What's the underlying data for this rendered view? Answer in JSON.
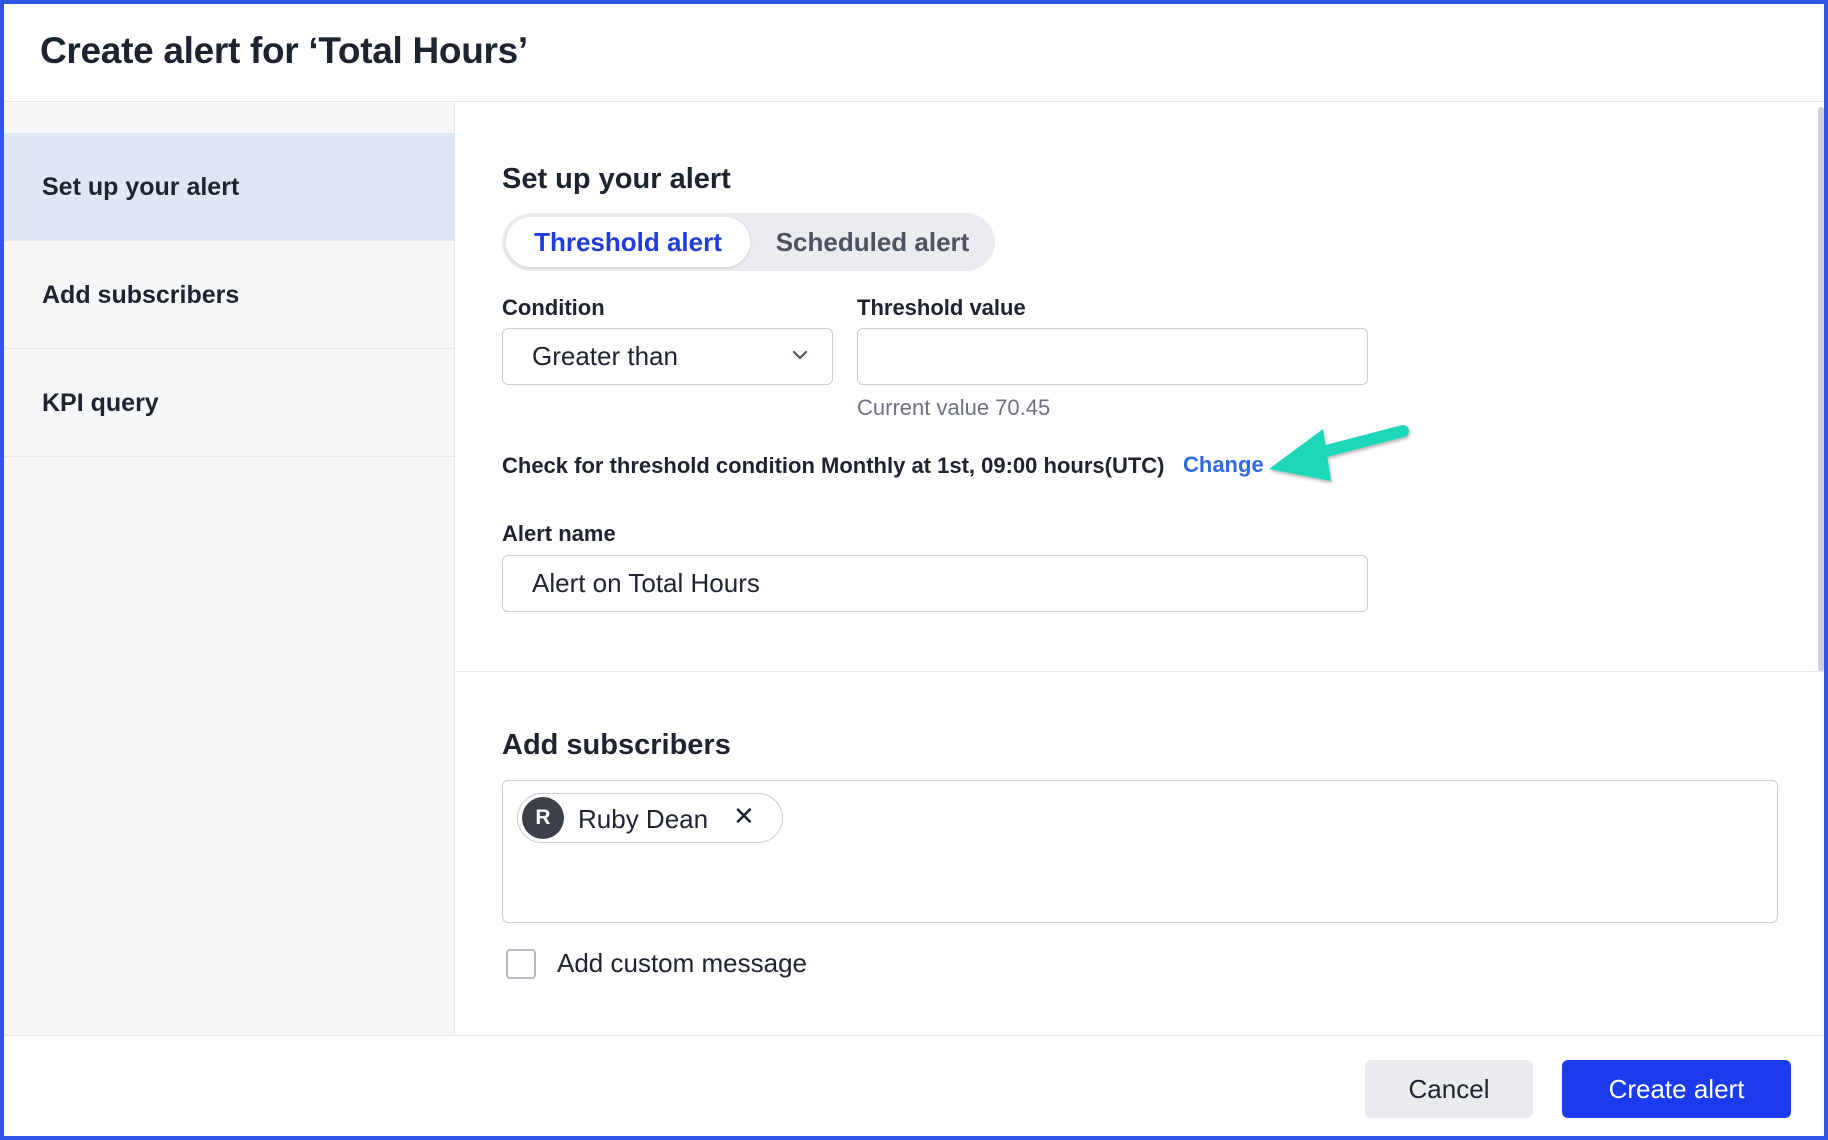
{
  "dialog": {
    "title": "Create alert for ‘Total Hours’"
  },
  "sidebar": {
    "items": [
      {
        "label": "Set up your alert",
        "active": true
      },
      {
        "label": "Add subscribers",
        "active": false
      },
      {
        "label": "KPI query",
        "active": false
      }
    ]
  },
  "setup": {
    "title": "Set up your alert",
    "alert_types": [
      {
        "label": "Threshold alert",
        "selected": true
      },
      {
        "label": "Scheduled alert",
        "selected": false
      }
    ],
    "condition": {
      "label": "Condition",
      "value": "Greater than"
    },
    "threshold": {
      "label": "Threshold value",
      "value": "",
      "hint": "Current value 70.45"
    },
    "schedule": {
      "text": "Check for threshold condition Monthly at 1st, 09:00 hours(UTC)",
      "link": "Change"
    },
    "alert_name": {
      "label": "Alert name",
      "value": "Alert on Total Hours"
    }
  },
  "subscribers": {
    "title": "Add subscribers",
    "list": [
      {
        "initial": "R",
        "name": "Ruby Dean"
      }
    ],
    "custom_message": {
      "label": "Add custom message",
      "checked": false
    }
  },
  "footer": {
    "cancel": "Cancel",
    "create": "Create alert"
  },
  "colors": {
    "accent": "#1b3bef",
    "link": "#2f6ae0",
    "annotation_arrow": "#1fd7b8",
    "active_sidebar": "#dfe7f7"
  },
  "icons": [
    "chevron-down-icon",
    "close-icon",
    "annotation-arrow-icon"
  ]
}
